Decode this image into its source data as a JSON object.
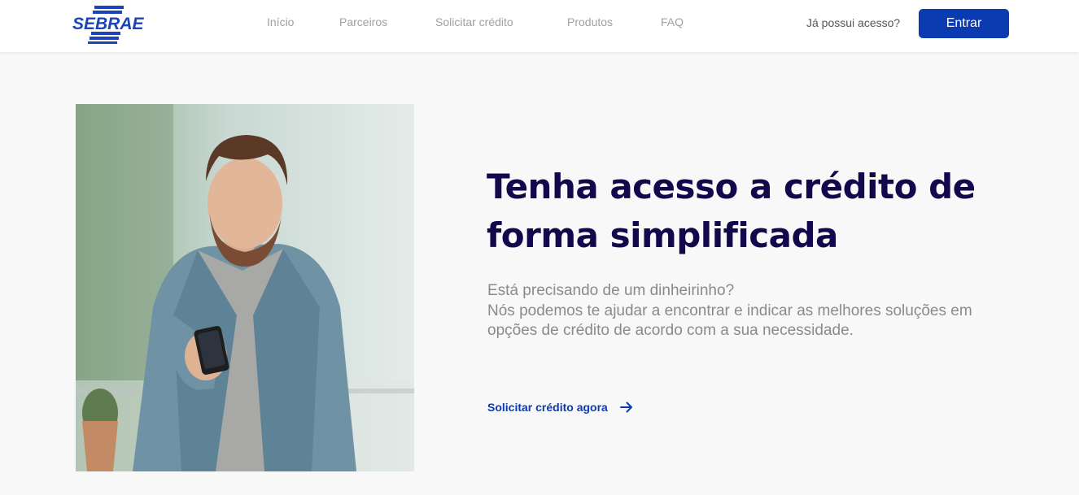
{
  "brand": {
    "logo_text": "SEBRAE",
    "color": "#1a44b8"
  },
  "nav": {
    "items": [
      {
        "label": "Início"
      },
      {
        "label": "Parceiros"
      },
      {
        "label": "Solicitar crédito"
      },
      {
        "label": "Produtos"
      },
      {
        "label": "FAQ"
      }
    ]
  },
  "auth": {
    "prompt": "Já possui acesso?",
    "enter_label": "Entrar"
  },
  "hero": {
    "title": "Tenha acesso a crédito de forma simplificada",
    "description_lines": [
      "Está precisando de um dinheirinho?",
      "Nós podemos te ajudar a encontrar e indicar as melhores soluções em opções de crédito de acordo com a sua necessidade."
    ],
    "cta_label": "Solicitar crédito agora",
    "cta_icon": "arrow-right-icon"
  },
  "colors": {
    "primary": "#0a3bb0",
    "title": "#12094d",
    "muted_text": "#8a8a8a",
    "nav_text": "#a0a0a0",
    "background": "#f8f8f8"
  }
}
